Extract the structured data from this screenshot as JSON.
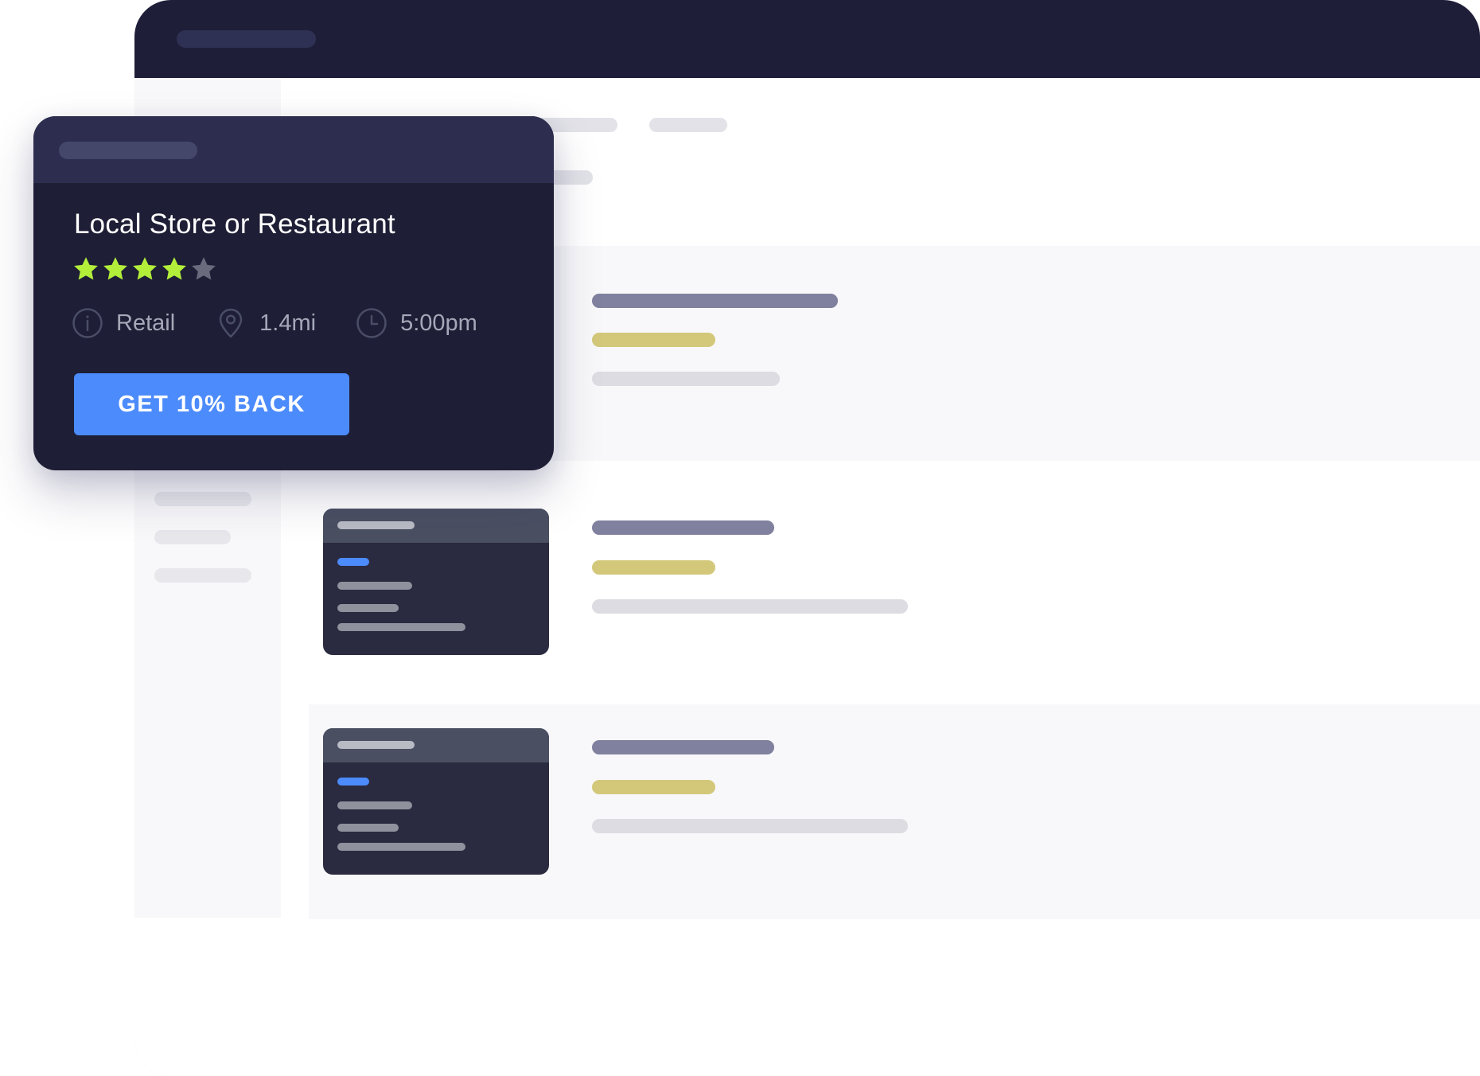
{
  "card": {
    "title": "Local Store or Restaurant",
    "rating": 4,
    "rating_max": 5,
    "category_icon": "info-icon",
    "category": "Retail",
    "distance_icon": "map-pin-icon",
    "distance": "1.4mi",
    "time_icon": "clock-icon",
    "time": "5:00pm",
    "cta_label": "GET 10% BACK"
  },
  "colors": {
    "window_bar": "#1e1e38",
    "card_background": "#1e1e36",
    "card_header": "#2d2e4f",
    "cta_background": "#4c8bfb",
    "star_filled": "#b3ef3a",
    "star_empty": "#6a6c7e",
    "result_title_bar": "#80809f",
    "result_accent_bar": "#d3c87a",
    "result_meta_bar": "#dcdce2"
  }
}
